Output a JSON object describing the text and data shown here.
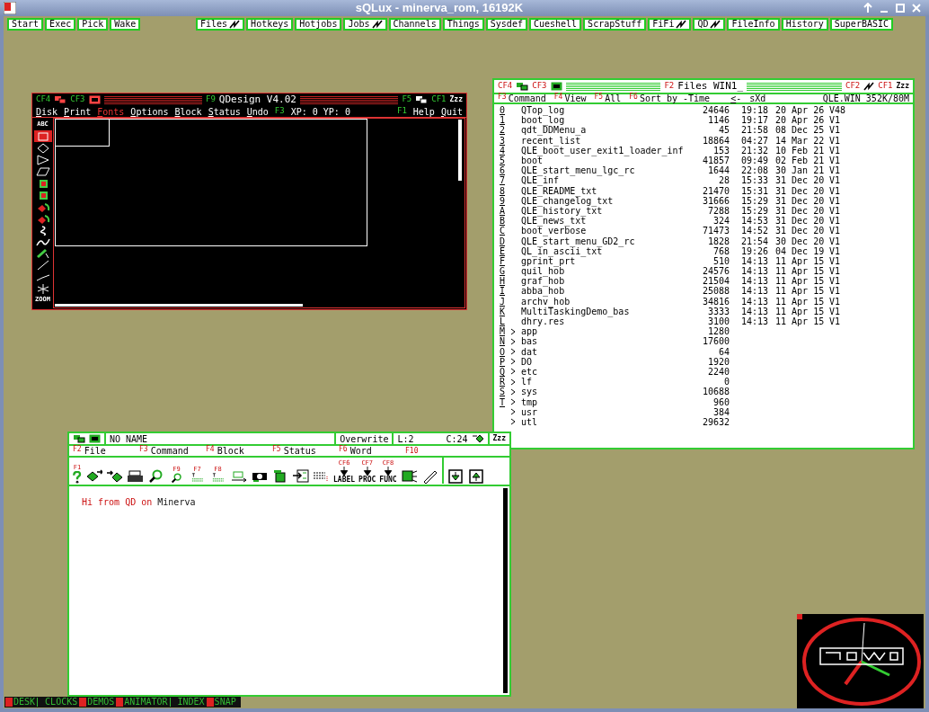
{
  "window": {
    "title": "sQLux - minerva_rom, 16192K"
  },
  "menu_bar": {
    "groups": [
      [
        {
          "label": "Start",
          "kind": "plain"
        },
        {
          "label": "Exec",
          "kind": "plain"
        },
        {
          "label": "Pick",
          "kind": "plain"
        },
        {
          "label": "Wake",
          "kind": "plain"
        }
      ],
      [
        {
          "label": "Files",
          "kind": "icon"
        },
        {
          "label": "Hotkeys",
          "kind": "plain"
        },
        {
          "label": "Hotjobs",
          "kind": "plain"
        },
        {
          "label": "Jobs",
          "kind": "icon"
        },
        {
          "label": "Channels",
          "kind": "plain"
        },
        {
          "label": "Things",
          "kind": "plain"
        },
        {
          "label": "Sysdef",
          "kind": "plain"
        },
        {
          "label": "Cueshell",
          "kind": "plain"
        },
        {
          "label": "ScrapStuff",
          "kind": "plain"
        },
        {
          "label": "FiFi",
          "kind": "icon"
        },
        {
          "label": "QD",
          "kind": "icon"
        },
        {
          "label": "FileInfo",
          "kind": "plain"
        },
        {
          "label": "History",
          "kind": "plain"
        },
        {
          "label": "SuperBASIC",
          "kind": "plain"
        }
      ]
    ]
  },
  "qdesign": {
    "title": {
      "left_keys": [
        "CF4",
        "CF3"
      ],
      "key": "F9",
      "text": "QDesign V4.02",
      "right_keys": [
        "F5",
        "CF1"
      ],
      "sleep": "Zzz"
    },
    "menu": [
      {
        "label": "Disk",
        "selected": false
      },
      {
        "label": "Print",
        "selected": false
      },
      {
        "label": "Fonts",
        "selected": true
      },
      {
        "label": "Options",
        "selected": false
      },
      {
        "label": "Block",
        "selected": false
      },
      {
        "label": "Status",
        "selected": false
      },
      {
        "label": "Undo",
        "selected": false
      }
    ],
    "coords": {
      "key": "F3",
      "text": "XP: 0 YP: 0"
    },
    "right_menu": [
      {
        "key": "F1",
        "label": "Help"
      },
      {
        "label": "Quit"
      }
    ],
    "tools": [
      {
        "kind": "text",
        "label": "ABC",
        "selected": false
      },
      {
        "kind": "rectangle",
        "selected": true
      },
      {
        "kind": "diamond",
        "selected": false
      },
      {
        "kind": "triangle",
        "selected": false
      },
      {
        "kind": "parallelogram",
        "selected": false
      },
      {
        "kind": "fill",
        "selected": false
      },
      {
        "kind": "fill",
        "selected": false
      },
      {
        "kind": "paint",
        "selected": false
      },
      {
        "kind": "paint",
        "selected": false
      },
      {
        "kind": "spiral",
        "selected": false
      },
      {
        "kind": "wave",
        "selected": false
      },
      {
        "kind": "brush",
        "selected": false
      },
      {
        "kind": "line",
        "selected": false
      },
      {
        "kind": "curve",
        "selected": false
      },
      {
        "kind": "star",
        "selected": false
      },
      {
        "kind": "zoom",
        "label": "ZOOM",
        "selected": false
      }
    ]
  },
  "files": {
    "title": {
      "left_keys": [
        "CF4",
        "CF3"
      ],
      "key": "F2",
      "text": "Files WIN1_",
      "right_keys": [
        "CF2",
        "CF1"
      ],
      "sleep": "Zzz"
    },
    "menu": [
      {
        "key": "F3",
        "label": "Command"
      },
      {
        "key": "F4",
        "label": "View"
      },
      {
        "key": "F5",
        "label": "All"
      },
      {
        "key": "F6",
        "label": "Sort by -Time"
      }
    ],
    "actions": [
      "<-",
      "sXd"
    ],
    "status": "QLE.WIN 352K/80M",
    "rows": [
      {
        "key": "0",
        "kind": "file",
        "name": "QTop_log",
        "size": "24646",
        "time": "19:18",
        "date": "20 Apr 26",
        "version": "V48"
      },
      {
        "key": "1",
        "kind": "file",
        "name": "boot_log",
        "size": "1146",
        "time": "19:17",
        "date": "20 Apr 26",
        "version": "V1"
      },
      {
        "key": "2",
        "kind": "file",
        "name": "qdt_DDMenu_a",
        "size": "45",
        "time": "21:58",
        "date": "08 Dec 25",
        "version": "V1"
      },
      {
        "key": "3",
        "kind": "file",
        "name": "recent_list",
        "size": "18864",
        "time": "04:27",
        "date": "14 Mar 22",
        "version": "V1"
      },
      {
        "key": "4",
        "kind": "file",
        "name": "QLE_boot_user_exit1_loader_inf",
        "size": "153",
        "time": "21:32",
        "date": "10 Feb 21",
        "version": "V1"
      },
      {
        "key": "5",
        "kind": "file",
        "name": "boot",
        "size": "41857",
        "time": "09:49",
        "date": "02 Feb 21",
        "version": "V1"
      },
      {
        "key": "6",
        "kind": "file",
        "name": "QLE_start_menu_lgc_rc",
        "size": "1644",
        "time": "22:08",
        "date": "30 Jan 21",
        "version": "V1"
      },
      {
        "key": "7",
        "kind": "file",
        "name": "QLE_inf",
        "size": "28",
        "time": "15:33",
        "date": "31 Dec 20",
        "version": "V1"
      },
      {
        "key": "8",
        "kind": "file",
        "name": "QLE_README_txt",
        "size": "21470",
        "time": "15:31",
        "date": "31 Dec 20",
        "version": "V1"
      },
      {
        "key": "9",
        "kind": "file",
        "name": "QLE_changelog_txt",
        "size": "31666",
        "time": "15:29",
        "date": "31 Dec 20",
        "version": "V1"
      },
      {
        "key": "A",
        "kind": "file",
        "name": "QLE_history_txt",
        "size": "7288",
        "time": "15:29",
        "date": "31 Dec 20",
        "version": "V1"
      },
      {
        "key": "B",
        "kind": "file",
        "name": "QLE_news_txt",
        "size": "324",
        "time": "14:53",
        "date": "31 Dec 20",
        "version": "V1"
      },
      {
        "key": "C",
        "kind": "file",
        "name": "boot_verbose",
        "size": "71473",
        "time": "14:52",
        "date": "31 Dec 20",
        "version": "V1"
      },
      {
        "key": "D",
        "kind": "file",
        "name": "QLE_start_menu_GD2_rc",
        "size": "1828",
        "time": "21:54",
        "date": "30 Dec 20",
        "version": "V1"
      },
      {
        "key": "E",
        "kind": "file",
        "name": "QL_in_ascii_txt",
        "size": "768",
        "time": "19:26",
        "date": "04 Dec 19",
        "version": "V1"
      },
      {
        "key": "F",
        "kind": "file",
        "name": "gprint_prt",
        "size": "510",
        "time": "14:13",
        "date": "11 Apr 15",
        "version": "V1"
      },
      {
        "key": "G",
        "kind": "file",
        "name": "quil_hob",
        "size": "24576",
        "time": "14:13",
        "date": "11 Apr 15",
        "version": "V1"
      },
      {
        "key": "H",
        "kind": "file",
        "name": "graf_hob",
        "size": "21504",
        "time": "14:13",
        "date": "11 Apr 15",
        "version": "V1"
      },
      {
        "key": "I",
        "kind": "file",
        "name": "abba_hob",
        "size": "25088",
        "time": "14:13",
        "date": "11 Apr 15",
        "version": "V1"
      },
      {
        "key": "J",
        "kind": "file",
        "name": "archv_hob",
        "size": "34816",
        "time": "14:13",
        "date": "11 Apr 15",
        "version": "V1"
      },
      {
        "key": "K",
        "kind": "file",
        "name": "MultiTaskingDemo_bas",
        "size": "3333",
        "time": "14:13",
        "date": "11 Apr 15",
        "version": "V1"
      },
      {
        "key": "L",
        "kind": "file",
        "name": "dhry.res",
        "size": "3100",
        "time": "14:13",
        "date": "11 Apr 15",
        "version": "V1"
      },
      {
        "key": "M",
        "kind": "dir",
        "name": "app",
        "size": "1280"
      },
      {
        "key": "N",
        "kind": "dir",
        "name": "bas",
        "size": "17600"
      },
      {
        "key": "O",
        "kind": "dir",
        "name": "dat",
        "size": "64"
      },
      {
        "key": "P",
        "kind": "dir",
        "name": "DO",
        "size": "1920"
      },
      {
        "key": "Q",
        "kind": "dir",
        "name": "etc",
        "size": "2240"
      },
      {
        "key": "R",
        "kind": "dir",
        "name": "lf",
        "size": "0"
      },
      {
        "key": "S",
        "kind": "dir",
        "name": "sys",
        "size": "10688"
      },
      {
        "key": "T",
        "kind": "dir",
        "name": "tmp",
        "size": "960"
      },
      {
        "kind": "dir",
        "name": "usr",
        "size": "384"
      },
      {
        "kind": "dir",
        "name": "utl",
        "size": "29632"
      }
    ]
  },
  "qd": {
    "title": {
      "name": "NO NAME",
      "mode": "Overwrite",
      "line": "L:2",
      "column": "C:24",
      "sleep": "Zzz"
    },
    "menu": [
      {
        "key": "F2",
        "label": "File"
      },
      {
        "key": "F3",
        "label": "Command"
      },
      {
        "key": "F4",
        "label": "Block"
      },
      {
        "key": "F5",
        "label": "Status"
      },
      {
        "key": "F6",
        "label": "Word"
      },
      {
        "key": "F10"
      }
    ],
    "toolbar": [
      {
        "kind": "help",
        "key": "F1"
      },
      {
        "kind": "save"
      },
      {
        "kind": "load"
      },
      {
        "kind": "print"
      },
      {
        "kind": "find"
      },
      {
        "kind": "find",
        "key": "F9"
      },
      {
        "kind": "mark",
        "key": "F7"
      },
      {
        "kind": "mark",
        "key": "F8"
      },
      {
        "kind": "move"
      },
      {
        "kind": "copy"
      },
      {
        "kind": "delete"
      },
      {
        "kind": "paste"
      },
      {
        "kind": "lines"
      },
      {
        "kind": "jump",
        "key": "CF6",
        "label": "LABEL"
      },
      {
        "kind": "jump",
        "key": "CF7",
        "label": "PROC"
      },
      {
        "kind": "jump",
        "key": "CF8",
        "label": "FUNC"
      },
      {
        "kind": "block"
      },
      {
        "kind": "pencil"
      },
      {
        "kind": "down"
      },
      {
        "kind": "up"
      }
    ],
    "text": [
      {
        "text": "Hi from QD on",
        "color": "#cc1111"
      },
      {
        "text": " Minerva",
        "color": "#111111"
      }
    ]
  },
  "taskbar": [
    {
      "label": "DESK",
      "flag": true
    },
    {
      "label": "CLOCKS",
      "flag": false
    },
    {
      "label": "DEMOS",
      "flag": true
    },
    {
      "label": "ANIMATOR",
      "flag": true
    },
    {
      "label": "INDEX",
      "flag": false
    },
    {
      "label": "SNAP",
      "flag": true
    }
  ]
}
